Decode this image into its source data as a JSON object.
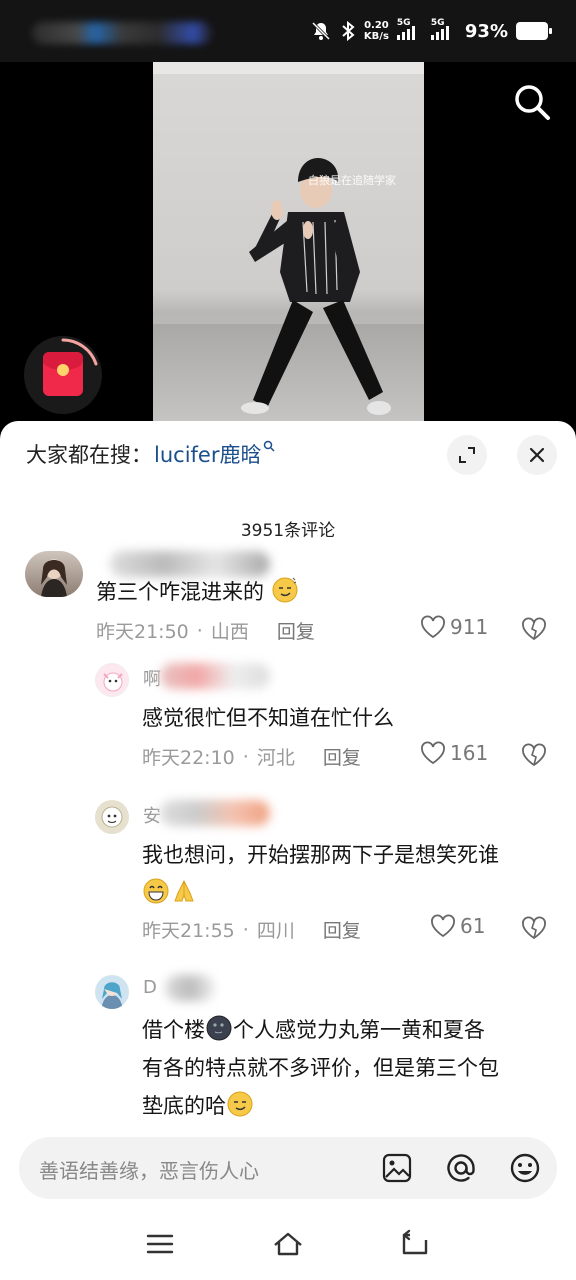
{
  "status_bar": {
    "net_speed_value": "0.20",
    "net_speed_unit": "KB/s",
    "sim1": "5G",
    "sim2": "5G",
    "battery": "93%"
  },
  "video": {
    "watermark": "白狼是在追随学家"
  },
  "comments_panel": {
    "search_prefix": "大家都在搜：",
    "search_keyword": "lucifer鹿晗",
    "count": "3951条评论",
    "comments": [
      {
        "text": "第三个咋混进来的",
        "time": "昨天21:50",
        "location": "山西",
        "reply": "回复",
        "likes": "911"
      },
      {
        "initial": "啊",
        "text": "感觉很忙但不知道在忙什么",
        "time": "昨天22:10",
        "location": "河北",
        "reply": "回复",
        "likes": "161"
      },
      {
        "initial": "安",
        "text": "我也想问，开始摆那两下子是想笑死谁",
        "time": "昨天21:55",
        "location": "四川",
        "reply": "回复",
        "likes": "61"
      },
      {
        "initial": "D",
        "line1_a": "借个楼",
        "line1_b": "个人感觉力丸第一黄和夏各",
        "line2": "有各的特点就不多评价，但是第三个包",
        "line3": "垫底的哈"
      }
    ]
  },
  "input": {
    "placeholder": "善语结善缘，恶言伤人心"
  },
  "colors": {
    "link": "#1b4e8c",
    "red_packet": "#f0284a"
  }
}
